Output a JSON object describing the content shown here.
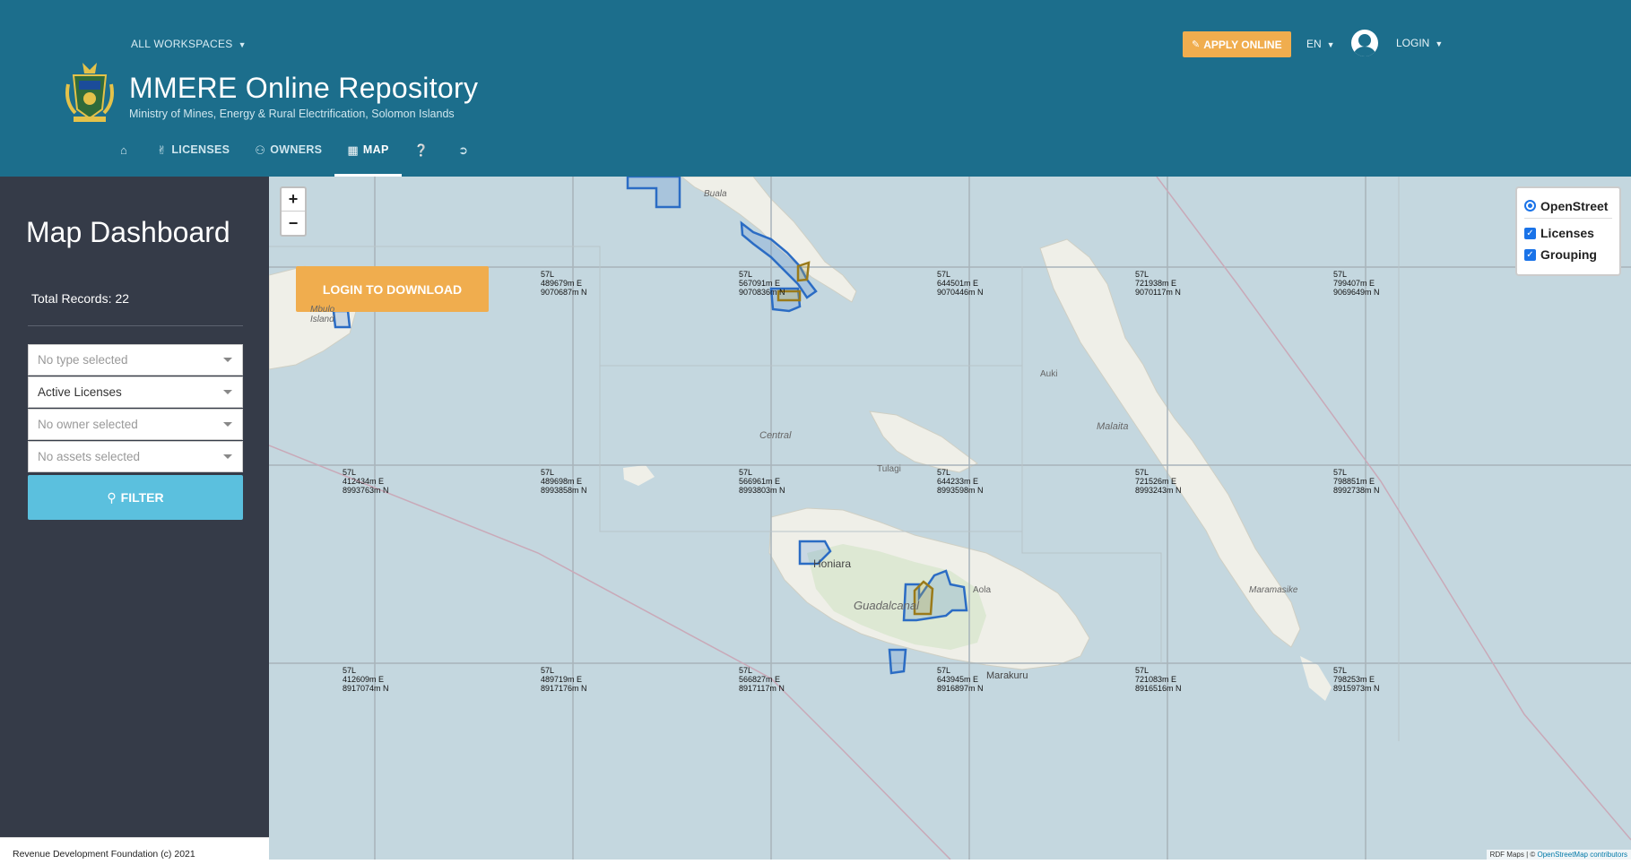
{
  "header": {
    "workspaces_label": "ALL WORKSPACES",
    "title": "MMERE Online Repository",
    "subtitle": "Ministry of Mines, Energy & Rural Electrification, Solomon Islands",
    "apply_label": "APPLY ONLINE",
    "lang_label": "EN",
    "login_label": "LOGIN"
  },
  "nav": {
    "licenses": "LICENSES",
    "owners": "OWNERS",
    "map": "MAP",
    "help_icon": "question-circle-icon",
    "signin_icon": "sign-in-icon"
  },
  "sidebar": {
    "title": "Map Dashboard",
    "total_label": "Total Records:",
    "total_value": "22",
    "type_placeholder": "No type selected",
    "license_value": "Active Licenses",
    "owner_placeholder": "No owner selected",
    "assets_placeholder": "No assets selected",
    "filter_label": "FILTER"
  },
  "footer": {
    "text": "Revenue Development Foundation (c) 2021"
  },
  "map": {
    "download_label": "LOGIN TO DOWNLOAD",
    "layers": {
      "base": "OpenStreet",
      "licenses": "Licenses",
      "grouping": "Grouping"
    },
    "attribution_a": "RDF Maps",
    "attribution_sep": " | © ",
    "attribution_b": "OpenStreetMap contributors",
    "places": {
      "buala": "Buala",
      "mbulo": "Mbulo",
      "island": "Island",
      "central": "Central",
      "tulagi": "Tulagi",
      "auki": "Auki",
      "malaita": "Malaita",
      "honiara": "Honiara",
      "aola": "Aola",
      "guadalcanal": "Guadalcanal",
      "maramasike": "Maramasike",
      "marakuru": "Marakuru"
    },
    "coords": [
      {
        "zone": "57L",
        "e": "489679m E",
        "n": "9070687m N"
      },
      {
        "zone": "57L",
        "e": "567091m E",
        "n": "9070836m N"
      },
      {
        "zone": "57L",
        "e": "644501m E",
        "n": "9070446m N"
      },
      {
        "zone": "57L",
        "e": "721938m E",
        "n": "9070117m N"
      },
      {
        "zone": "57L",
        "e": "799407m E",
        "n": "9069649m N"
      },
      {
        "zone": "57L",
        "e": "412434m E",
        "n": "8993763m N"
      },
      {
        "zone": "57L",
        "e": "489698m E",
        "n": "8993858m N"
      },
      {
        "zone": "57L",
        "e": "566961m E",
        "n": "8993803m N"
      },
      {
        "zone": "57L",
        "e": "644233m E",
        "n": "8993598m N"
      },
      {
        "zone": "57L",
        "e": "721526m E",
        "n": "8993243m N"
      },
      {
        "zone": "57L",
        "e": "798851m E",
        "n": "8992738m N"
      },
      {
        "zone": "57L",
        "e": "412609m E",
        "n": "8917074m N"
      },
      {
        "zone": "57L",
        "e": "489719m E",
        "n": "8917176m N"
      },
      {
        "zone": "57L",
        "e": "566827m E",
        "n": "8917117m N"
      },
      {
        "zone": "57L",
        "e": "643945m E",
        "n": "8916897m N"
      },
      {
        "zone": "57L",
        "e": "721083m E",
        "n": "8916516m N"
      },
      {
        "zone": "57L",
        "e": "798253m E",
        "n": "8915973m N"
      }
    ]
  },
  "colors": {
    "header_bg": "#1c6e8c",
    "sidebar_bg": "#353b48",
    "accent_orange": "#f0ad4e",
    "filter_blue": "#5bc0de",
    "license_stroke": "#2b6cc4",
    "grouping_stroke": "#9a7a1a"
  }
}
